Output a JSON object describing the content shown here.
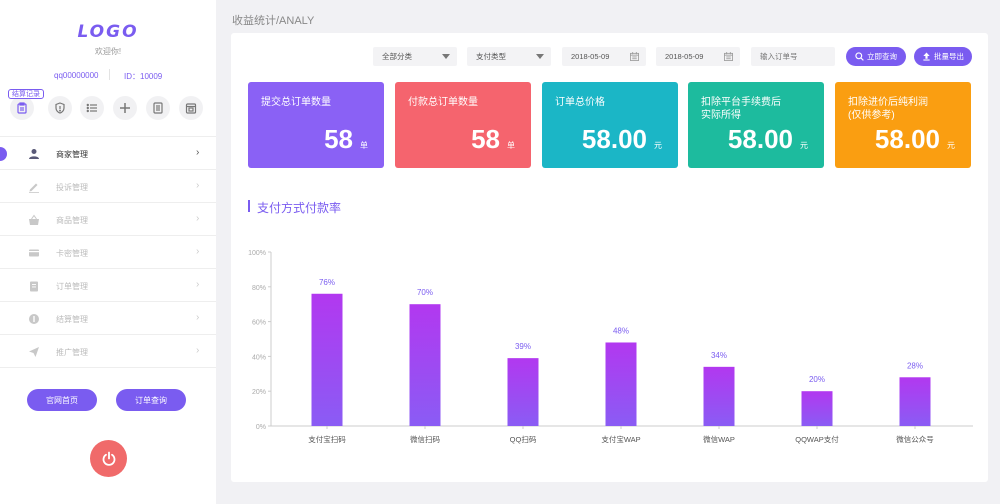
{
  "sidebar": {
    "logo": "LOGO",
    "welcome": "欢迎你!",
    "qq": "qq00000000",
    "uid": "ID：10009",
    "badge": "结算记录",
    "quick_icons": [
      "clipboard-icon",
      "shield-icon",
      "list-icon",
      "plus-icon",
      "document-icon",
      "calendar-icon"
    ],
    "nav": [
      {
        "label": "商家管理",
        "icon": "user-icon",
        "active": true
      },
      {
        "label": "投诉管理",
        "icon": "pencil-icon",
        "active": false
      },
      {
        "label": "商品管理",
        "icon": "basket-icon",
        "active": false
      },
      {
        "label": "卡密管理",
        "icon": "card-icon",
        "active": false
      },
      {
        "label": "订单管理",
        "icon": "clipboard-icon",
        "active": false
      },
      {
        "label": "结算管理",
        "icon": "coin-icon",
        "active": false
      },
      {
        "label": "推广管理",
        "icon": "send-icon",
        "active": false
      }
    ],
    "btn_home": "官网首页",
    "btn_order": "订单查询",
    "power_icon": "power-icon"
  },
  "breadcrumb": "收益统计/ANALY",
  "filters": {
    "category": "全部分类",
    "pay_type": "支付类型",
    "date_start": "2018-05-09",
    "date_end": "2018-05-09",
    "order_placeholder": "输入订单号",
    "query_label": "立即查询",
    "export_label": "批量导出"
  },
  "cards": [
    {
      "title": "提交总订单数量",
      "value": "58",
      "unit": "单",
      "color": "#8a61f5"
    },
    {
      "title": "付款总订单数量",
      "value": "58",
      "unit": "单",
      "color": "#f5646e"
    },
    {
      "title": "订单总价格",
      "value": "58.00",
      "unit": "元",
      "color": "#1bb6c6"
    },
    {
      "title": "扣除平台手续费后\n实际所得",
      "value": "58.00",
      "unit": "元",
      "color": "#1dbb9e"
    },
    {
      "title": "扣除进价后纯利润\n(仅供参考)",
      "value": "58.00",
      "unit": "元",
      "color": "#fa9e11"
    }
  ],
  "section_title": "支付方式付款率",
  "chart_data": {
    "type": "bar",
    "categories": [
      "支付宝扫码",
      "微信扫码",
      "QQ扫码",
      "支付宝WAP",
      "微信WAP",
      "QQWAP支付",
      "微信公众号"
    ],
    "values": [
      76,
      70,
      39,
      48,
      34,
      20,
      28
    ],
    "data_labels": [
      "76%",
      "70%",
      "39%",
      "48%",
      "34%",
      "20%",
      "28%"
    ],
    "yticks": [
      "0%",
      "20%",
      "40%",
      "60%",
      "80%",
      "100%"
    ],
    "ylim": [
      0,
      100
    ],
    "bar_color_top": "#b238f0",
    "bar_color_bottom": "#8a5cf4",
    "grid": false
  }
}
